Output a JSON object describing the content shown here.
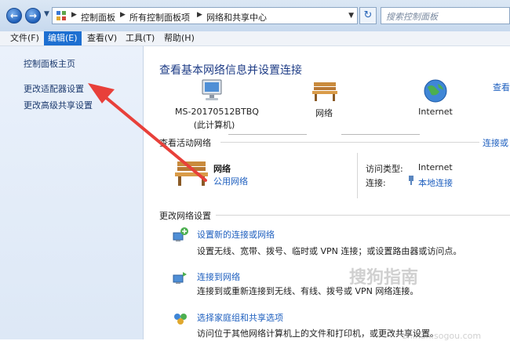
{
  "address_bar": {
    "breadcrumbs": [
      "控制面板",
      "所有控制面板项",
      "网络和共享中心"
    ],
    "search_placeholder": "搜索控制面板"
  },
  "menu": [
    "文件(F)",
    "编辑(E)",
    "查看(V)",
    "工具(T)",
    "帮助(H)"
  ],
  "menu_active_index": 1,
  "sidebar": {
    "items": [
      "控制面板主页",
      "更改适配器设置",
      "更改高级共享设置"
    ]
  },
  "main": {
    "title": "查看基本网络信息并设置连接",
    "view_full_map": "查看",
    "map": {
      "computer": "MS-20170512BTBQ",
      "computer_sub": "(此计算机)",
      "network": "网络",
      "internet": "Internet"
    },
    "active_networks": {
      "heading": "查看活动网络",
      "connect_link": "连接或",
      "network_name": "网络",
      "network_type": "公用网络",
      "access_type_label": "访问类型:",
      "access_type_value": "Internet",
      "connections_label": "连接:",
      "connections_value": "本地连接"
    },
    "change_settings": {
      "heading": "更改网络设置",
      "tasks": [
        {
          "title": "设置新的连接或网络",
          "desc": "设置无线、宽带、拨号、临时或 VPN 连接；或设置路由器或访问点。"
        },
        {
          "title": "连接到网络",
          "desc": "连接到或重新连接到无线、有线、拨号或 VPN 网络连接。"
        },
        {
          "title": "选择家庭组和共享选项",
          "desc": "访问位于其他网络计算机上的文件和打印机，或更改共享设置。"
        }
      ]
    }
  },
  "watermark": {
    "text": "搜狗指南",
    "url": "zhinan.sogou.com"
  },
  "colors": {
    "link": "#1e5fbf",
    "title": "#1e3c86",
    "arrow": "#e8403a",
    "menu_active": "#1d6fd1"
  }
}
